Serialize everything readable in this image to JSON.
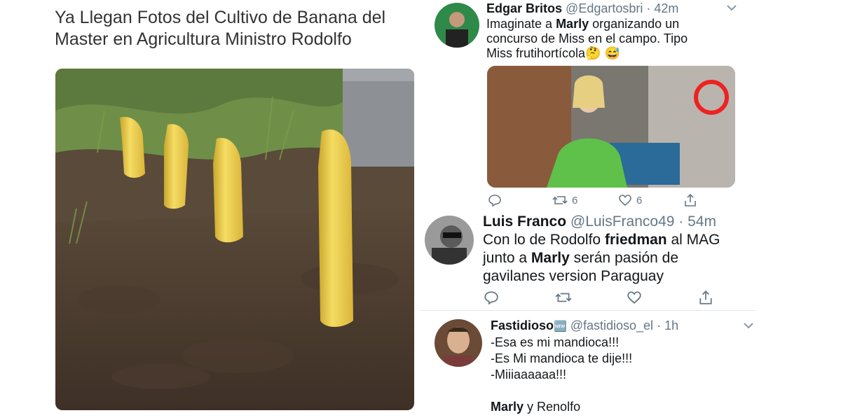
{
  "meme": {
    "title_line1": "Ya Llegan Fotos del Cultivo de Banana del",
    "title_line2": "Master en Agricultura Ministro Rodolfo"
  },
  "tweets": [
    {
      "name": "Edgar Britos",
      "handle": "@Edgartosbri",
      "time": "· 42m",
      "text_l1_a": "Imaginate a ",
      "text_l1_b": "Marly",
      "text_l1_c": " organizando un",
      "text_l2": "concurso de Miss en el campo. Tipo",
      "text_l3": "Miss frutihortícola",
      "emoji": "🤔 😅",
      "retweets": "6",
      "likes": "6"
    },
    {
      "name": "Luis Franco",
      "handle": "@LuisFranco49",
      "time": "· 54m",
      "text_l1_a": "Con lo de Rodolfo ",
      "text_l1_b": "friedman",
      "text_l1_c": " al MAG",
      "text_l2_a": "junto a ",
      "text_l2_b": "Marly",
      "text_l2_c": " serán pasión de",
      "text_l3": "gavilanes version Paraguay"
    },
    {
      "name": "Fastidioso",
      "badge": "🆕",
      "handle": "@fastidioso_el",
      "time": "· 1h",
      "line1": "-Esa es mi mandioca!!!",
      "line2": "-Es Mi mandioca te dije!!!",
      "line3": "-Miiiaaaaaa!!!",
      "line4_a": "Marly",
      "line4_b": " y Renolfo"
    }
  ],
  "colors": {
    "text": "#14171a",
    "muted": "#657786",
    "divider": "#e1e8ed",
    "banana": "#f1d356",
    "soil": "#4a3a2e"
  },
  "icons": [
    "reply-icon",
    "retweet-icon",
    "like-icon",
    "share-icon",
    "chevron-down-icon"
  ]
}
